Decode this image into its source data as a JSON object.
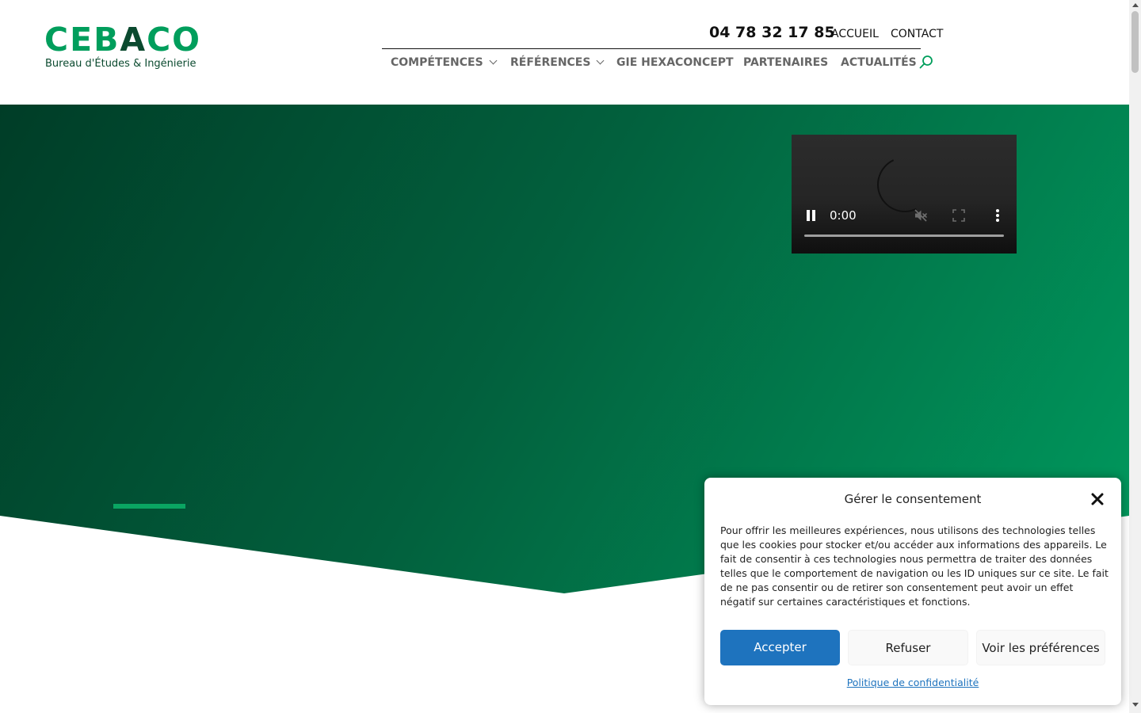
{
  "header": {
    "logo": {
      "text_part1": "CEB",
      "text_part2": "A",
      "text_part3": "CO",
      "subtitle": "Bureau d'Études & Ingénierie"
    },
    "phone": "04 78 32 17 85",
    "top_links": [
      "ACCUEIL",
      "CONTACT"
    ],
    "nav": [
      {
        "label": "COMPÉTENCES",
        "has_dropdown": true
      },
      {
        "label": "RÉFÉRENCES",
        "has_dropdown": true
      },
      {
        "label": "GIE HEXACONCEPT",
        "has_dropdown": false
      },
      {
        "label": "PARTENAIRES",
        "has_dropdown": false
      },
      {
        "label": "ACTUALITÉS",
        "has_dropdown": false
      }
    ],
    "search_icon": "search-icon"
  },
  "video": {
    "time": "0:00",
    "state": "loading",
    "muted": true
  },
  "consent": {
    "title": "Gérer le consentement",
    "body": "Pour offrir les meilleures expériences, nous utilisons des technologies telles que les cookies pour stocker et/ou accéder aux informations des appareils. Le fait de consentir à ces technologies nous permettra de traiter des données telles que le comportement de navigation ou les ID uniques sur ce site. Le fait de ne pas consentir ou de retirer son consentement peut avoir un effet négatif sur certaines caractéristiques et fonctions.",
    "accept_label": "Accepter",
    "refuse_label": "Refuser",
    "preferences_label": "Voir les préférences",
    "privacy_link": "Politique de confidentialité"
  },
  "colors": {
    "brand_green": "#009e5c",
    "brand_dark_green": "#0b4a2f",
    "hero_gradient_start": "#003d27",
    "hero_gradient_end": "#009a5e",
    "accept_button": "#1e73be"
  }
}
